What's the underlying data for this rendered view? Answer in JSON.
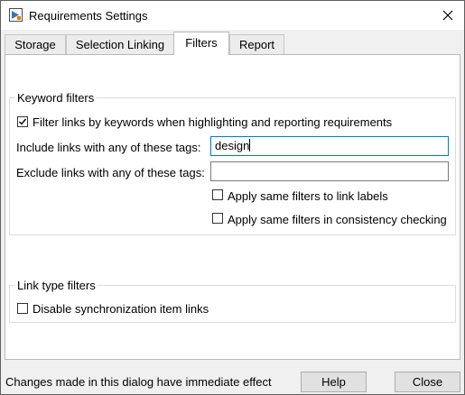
{
  "window": {
    "title": "Requirements Settings"
  },
  "tabs": [
    {
      "label": "Storage",
      "active": false
    },
    {
      "label": "Selection Linking",
      "active": false
    },
    {
      "label": "Filters",
      "active": true
    },
    {
      "label": "Report",
      "active": false
    }
  ],
  "keyword_filters": {
    "title": "Keyword filters",
    "filter_by_keywords": {
      "label": "Filter links by keywords when highlighting and reporting requirements",
      "checked": true
    },
    "include_tags": {
      "label": "Include links with any of these tags:",
      "value": "design"
    },
    "exclude_tags": {
      "label": "Exclude links with any of these tags:",
      "value": ""
    },
    "apply_to_labels": {
      "label": "Apply same filters to link labels",
      "checked": false
    },
    "apply_to_consistency": {
      "label": "Apply same filters in consistency checking",
      "checked": false
    }
  },
  "link_type_filters": {
    "title": "Link type filters",
    "disable_sync_links": {
      "label": "Disable synchronization item links",
      "checked": false
    }
  },
  "footer": {
    "status": "Changes made in this dialog have immediate effect",
    "help_label": "Help",
    "close_label": "Close"
  }
}
